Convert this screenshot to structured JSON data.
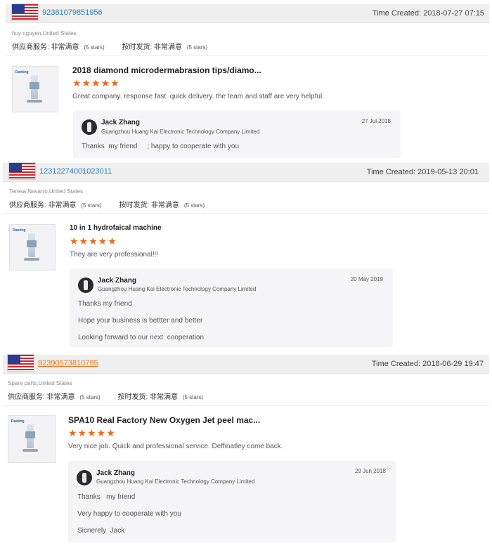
{
  "reviews": [
    {
      "order_no": "92381079851956",
      "time_label": "Time Created:",
      "time_value": "2018-07-27 07:15",
      "buyer": "huy nguyen,United States",
      "rating_service_label": "供应商服务:",
      "rating_service_value": "非常满意",
      "rating_service_stars": "(5 stars)",
      "rating_ship_label": "按时发货:",
      "rating_ship_value": "非常满意",
      "rating_ship_stars": "(5 stars)",
      "product_brand": "Danting",
      "product_title": "2018 diamond microdermabrasion tips/diamo...",
      "stars": "★★★★★",
      "star_count": 5,
      "comment": "Great company. response fast. quick delivery. the team and staff are very helpful.",
      "reply": {
        "name": "Jack Zhang",
        "company": "Guangzhou Huang Kai Electronic Technology Company Limited",
        "date": "27 Jul 2018",
        "lines": [
          "Thanks  my friend     ; happy to cooperate with you"
        ]
      }
    },
    {
      "order_no": "12312274001023011",
      "time_label": "Time Created:",
      "time_value": "2019-05-13 20:01",
      "buyer": "Teresa Navarro,United States",
      "rating_service_label": "供应商服务:",
      "rating_service_value": "非常满意",
      "rating_service_stars": "(5 stars)",
      "rating_ship_label": "按时发货:",
      "rating_ship_value": "非常满意",
      "rating_ship_stars": "(5 stars)",
      "product_brand": "Danting",
      "product_title": "10 in 1 hydrofaical machine",
      "stars": "★★★★★",
      "star_count": 5,
      "comment": "They are very professional!!!",
      "reply": {
        "name": "Jack Zhang",
        "company": "Guangzhou Huang Kai Electronic Technology Company Limited",
        "date": "20 May 2019",
        "lines": [
          "Thanks my friend",
          "Hope your business is bettter and better",
          "Looking forward to our next  cooperation"
        ]
      }
    },
    {
      "order_no": "92390573810795",
      "time_label": "Time Created:",
      "time_value": "2018-06-29 19:47",
      "buyer": "Spare parts,United States",
      "rating_service_label": "供应商服务:",
      "rating_service_value": "非常满意",
      "rating_service_stars": "(5 stars)",
      "rating_ship_label": "按时发货:",
      "rating_ship_value": "非常满意",
      "rating_ship_stars": "(5 stars)",
      "product_brand": "Danting",
      "product_title": "SPA10 Real Factory New Oxygen Jet peel mac...",
      "stars": "★★★★★",
      "star_count": 5,
      "comment": "Very nice job. Quick and professional service. Deffinatley come back.",
      "reply": {
        "name": "Jack Zhang",
        "company": "Guangzhou Huang Kai Electronic Technology Company Limited",
        "date": "29 Jun 2018",
        "lines": [
          "Thanks   my friend",
          "Very happy to cooperate with you",
          "Sicnerely  Jack"
        ]
      }
    }
  ],
  "colors": {
    "link_blue": "#2c7fbf",
    "link_orange": "#e8701a",
    "star": "#f06a1d",
    "header_bg": "#efefef",
    "reply_bg": "#f5f5f7"
  }
}
